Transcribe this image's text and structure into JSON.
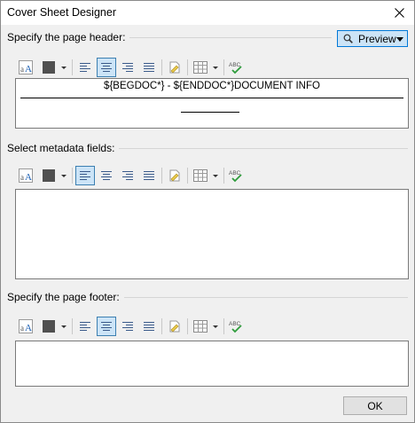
{
  "window": {
    "title": "Cover Sheet Designer"
  },
  "header_section": {
    "legend": "Specify the page header:",
    "preview_label": "Preview",
    "content": "${BEGDOC*} - ${ENDDOC*}DOCUMENT INFO",
    "alignment": "center"
  },
  "metadata_section": {
    "legend": "Select metadata fields:",
    "content": "",
    "alignment": "left"
  },
  "footer_section": {
    "legend": "Specify the page footer:",
    "content": "",
    "alignment": "center"
  },
  "toolbar_icons": [
    "font-icon",
    "text-color-icon",
    "align-left-icon",
    "align-center-icon",
    "align-right-icon",
    "align-justify-icon",
    "insert-field-icon",
    "insert-table-icon",
    "spell-check-icon"
  ],
  "colors": {
    "accent": "#0078d7",
    "active_bg": "#cce4f7",
    "text_color_swatch": "#505050"
  },
  "ok_label": "OK"
}
